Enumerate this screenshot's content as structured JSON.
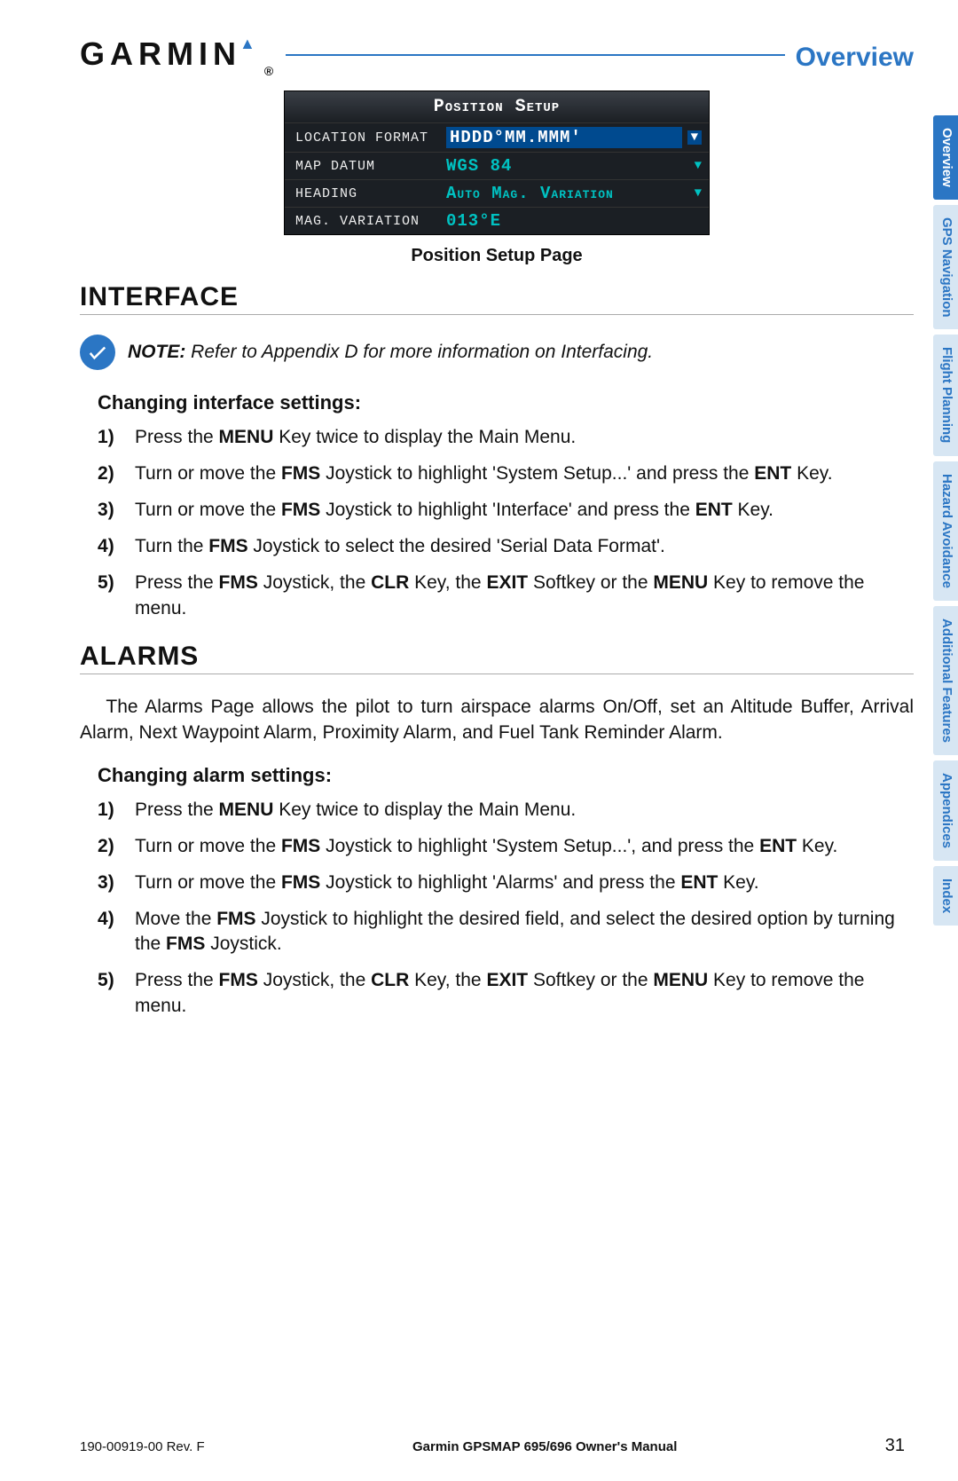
{
  "header": {
    "brand": "GARMIN",
    "section": "Overview"
  },
  "tabs": [
    {
      "label": "Overview",
      "active": true
    },
    {
      "label": "GPS Navigation",
      "active": false
    },
    {
      "label": "Flight Planning",
      "active": false
    },
    {
      "label": "Hazard Avoidance",
      "active": false
    },
    {
      "label": "Additional Features",
      "active": false
    },
    {
      "label": "Appendices",
      "active": false
    },
    {
      "label": "Index",
      "active": false
    }
  ],
  "screenshot": {
    "title": "Position Setup",
    "rows": [
      {
        "label": "LOCATION FORMAT",
        "value": "HDDD°MM.MMM'",
        "highlight": true,
        "dropdown": true
      },
      {
        "label": "MAP DATUM",
        "value": "WGS 84",
        "highlight": false,
        "dropdown": true
      },
      {
        "label": "HEADING",
        "value": "Auto Mag. Variation",
        "highlight": false,
        "dropdown": true
      },
      {
        "label": "MAG. VARIATION",
        "value": "013°E",
        "highlight": false,
        "dropdown": false
      }
    ],
    "caption": "Position Setup Page"
  },
  "interface": {
    "heading": "INTERFACE",
    "note_label": "NOTE:",
    "note_text": " Refer to Appendix D for more information on Interfacing.",
    "subhead": "Changing interface settings:",
    "steps_html": [
      "Press the <strong class='k'>MENU</strong> Key twice to display the Main Menu.",
      "Turn or move the <strong class='k'>FMS</strong> Joystick to highlight 'System Setup...' and press the <strong class='k'>ENT</strong> Key.",
      "Turn or move the <strong class='k'>FMS</strong> Joystick to highlight 'Interface' and press the <strong class='k'>ENT</strong> Key.",
      "Turn the <strong class='k'>FMS</strong> Joystick to select the desired 'Serial Data Format'.",
      "Press the <strong class='k'>FMS</strong> Joystick, the <strong class='k'>CLR</strong> Key, the <strong class='k'>EXIT</strong> Softkey or the <strong class='k'>MENU</strong> Key to remove the menu."
    ]
  },
  "alarms": {
    "heading": "ALARMS",
    "body": "The Alarms Page allows the pilot to turn airspace alarms On/Off, set an Altitude Buffer, Arrival Alarm, Next Waypoint Alarm, Proximity Alarm, and Fuel Tank Reminder Alarm.",
    "subhead": "Changing alarm settings:",
    "steps_html": [
      "Press the <strong class='k'>MENU</strong> Key twice to display the Main Menu.",
      "Turn or move the <strong class='k'>FMS</strong> Joystick to highlight 'System Setup...', and press the <strong class='k'>ENT</strong> Key.",
      "Turn or move the <strong class='k'>FMS</strong> Joystick to highlight 'Alarms' and press the <strong class='k'>ENT</strong> Key.",
      "Move the <strong class='k'>FMS</strong> Joystick to highlight the desired field, and select the desired option by turning the <strong class='k'>FMS</strong> Joystick.",
      "Press the <strong class='k'>FMS</strong> Joystick, the <strong class='k'>CLR</strong> Key, the <strong class='k'>EXIT</strong> Softkey or the <strong class='k'>MENU</strong> Key to remove the menu."
    ]
  },
  "footer": {
    "rev": "190-00919-00 Rev. F",
    "title": "Garmin GPSMAP 695/696 Owner's Manual",
    "page": "31"
  }
}
